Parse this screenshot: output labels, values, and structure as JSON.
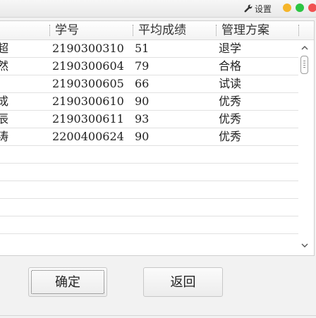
{
  "window": {
    "settings_label": "设置",
    "settings_icon": "wrench-icon",
    "controls": {
      "minimize_color": "#f5b52a",
      "maximize_color": "#2cc543",
      "close_color": "#f05252"
    }
  },
  "table": {
    "columns": [
      "学号",
      "平均成绩",
      "管理方案"
    ],
    "rows": [
      {
        "name": "超",
        "id": "2190300310",
        "score": "51",
        "plan": "退学"
      },
      {
        "name": "然",
        "id": "2190300604",
        "score": "79",
        "plan": "合格"
      },
      {
        "name": "",
        "id": "2190300605",
        "score": "66",
        "plan": "试读"
      },
      {
        "name": "成",
        "id": "2190300610",
        "score": "90",
        "plan": "优秀"
      },
      {
        "name": "辰",
        "id": "2190300611",
        "score": "93",
        "plan": "优秀"
      },
      {
        "name": "涛",
        "id": "2200400624",
        "score": "90",
        "plan": "优秀"
      }
    ],
    "empty_rows": 5
  },
  "buttons": {
    "ok_label": "确定",
    "back_label": "返回"
  }
}
